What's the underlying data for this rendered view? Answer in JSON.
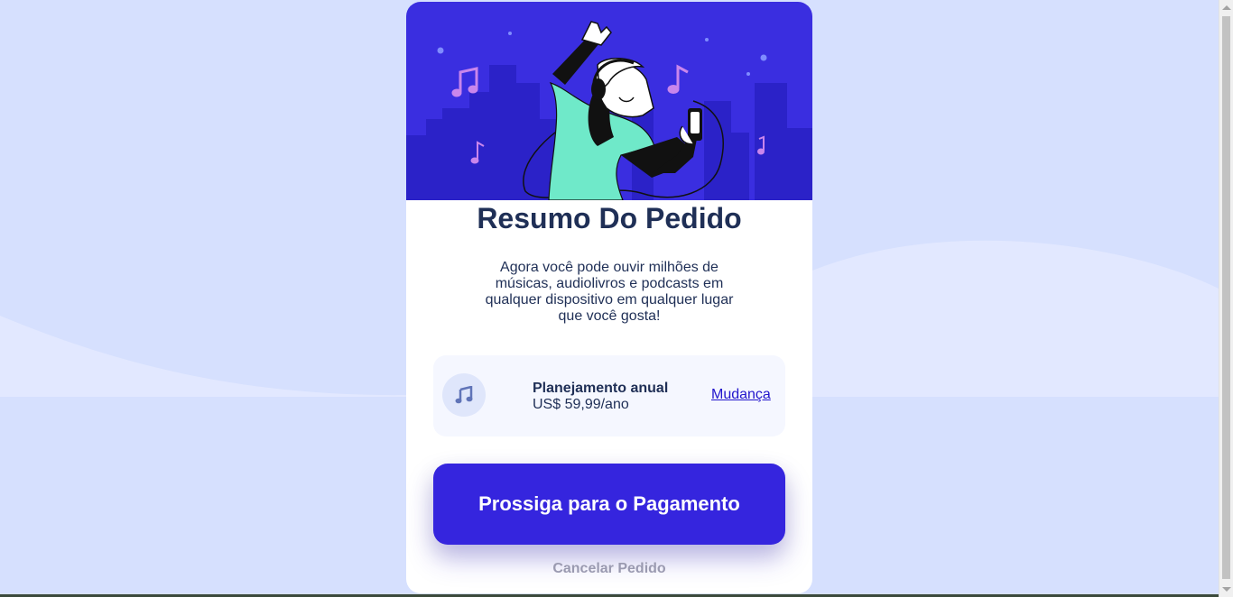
{
  "hero": {
    "image": "person-dancing-with-headphones-illustration"
  },
  "summary": {
    "title": "Resumo Do Pedido",
    "description": "Agora você pode ouvir milhões de músicas, audiolivros e podcasts em qualquer dispositivo em qualquer lugar que você gosta!"
  },
  "plan": {
    "icon": "music-note-icon",
    "name": "Planejamento anual",
    "price": "US$ 59,99/ano",
    "change_label": "Mudança"
  },
  "actions": {
    "proceed_label": "Prossiga para o Pagamento",
    "cancel_label": "Cancelar Pedido"
  },
  "colors": {
    "page_bg": "#d6e0fe",
    "primary": "#3525de",
    "heading": "#1f2f56",
    "link": "#2215cc",
    "muted": "#9a9ab0"
  }
}
